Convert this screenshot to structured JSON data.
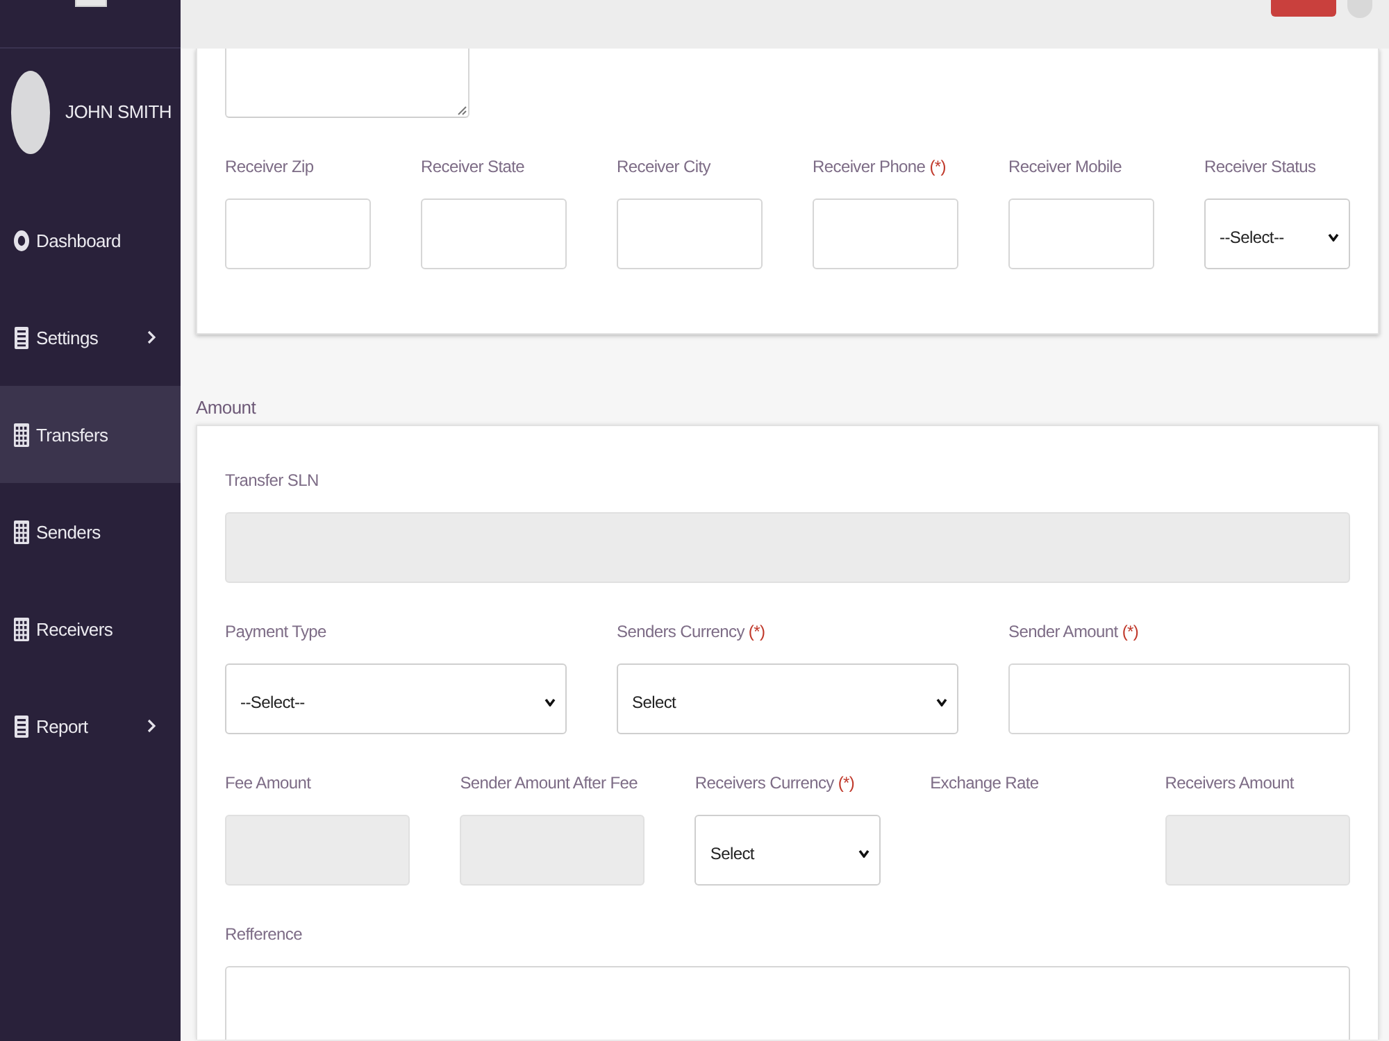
{
  "sidebar": {
    "user": {
      "name": "JOHN SMITH"
    },
    "items": [
      {
        "label": "Dashboard",
        "selected": false,
        "has_submenu": false
      },
      {
        "label": "Settings",
        "selected": false,
        "has_submenu": true
      },
      {
        "label": "Transfers",
        "selected": true,
        "has_submenu": false
      },
      {
        "label": "Senders",
        "selected": false,
        "has_submenu": false
      },
      {
        "label": "Receivers",
        "selected": false,
        "has_submenu": false
      },
      {
        "label": "Report",
        "selected": false,
        "has_submenu": true
      }
    ]
  },
  "receiver_section": {
    "fields": [
      {
        "label": "Receiver Zip",
        "kind": "input",
        "disabled": false
      },
      {
        "label": "Receiver State",
        "kind": "input",
        "disabled": false
      },
      {
        "label": "Receiver City",
        "kind": "input",
        "disabled": false
      },
      {
        "label": "Receiver Phone",
        "required_mark": "(*)",
        "kind": "input",
        "disabled": false
      },
      {
        "label": "Receiver Mobile",
        "kind": "input",
        "disabled": false
      },
      {
        "label": "Receiver Status",
        "kind": "select",
        "value": "--Select--",
        "disabled": false
      }
    ]
  },
  "amount_section": {
    "title": "Amount",
    "rows": [
      {
        "fields": [
          {
            "label": "Transfer SLN",
            "kind": "input",
            "disabled": true
          }
        ]
      },
      {
        "fields": [
          {
            "label": "Payment Type",
            "kind": "select",
            "value": "--Select--",
            "disabled": false
          },
          {
            "label": "Senders Currency",
            "required_mark": "(*)",
            "kind": "select",
            "value": "Select",
            "disabled": false
          },
          {
            "label": "Sender Amount",
            "required_mark": "(*)",
            "kind": "input",
            "disabled": false
          }
        ]
      },
      {
        "fields": [
          {
            "label": "Fee Amount",
            "kind": "input",
            "disabled": true
          },
          {
            "label": "Sender Amount After Fee",
            "kind": "input",
            "disabled": true
          },
          {
            "label": "Receivers Currency",
            "required_mark": "(*)",
            "kind": "select",
            "value": "Select",
            "disabled": false
          },
          {
            "label": "Exchange Rate",
            "kind": "label_only"
          },
          {
            "label": "Receivers Amount",
            "kind": "input",
            "disabled": true
          }
        ]
      },
      {
        "fields": [
          {
            "label": "Refference",
            "kind": "textarea",
            "disabled": false
          }
        ]
      }
    ]
  }
}
